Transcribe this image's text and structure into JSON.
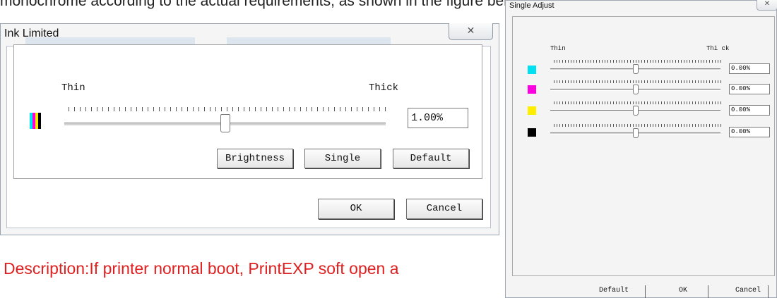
{
  "doc": {
    "top_text": "monochrome according to the actual requirements, as shown in the figure below",
    "bottom_text": "Description:If printer normal boot, PrintEXP soft open a"
  },
  "ink_limited": {
    "title": "Ink Limited",
    "close_glyph": "✕",
    "label_thin": "Thin",
    "label_thick": "Thick",
    "ink_colors": [
      "#00e5ee",
      "#ff00d8",
      "#f5e800",
      "#000000"
    ],
    "slider_level": 0.5,
    "value": "1.00%",
    "buttons": {
      "brightness": "Brightness",
      "single": "Single",
      "default": "Default"
    },
    "ok": "OK",
    "cancel": "Cancel"
  },
  "single_adjust": {
    "title": "Single Adjust",
    "close_glyph": "✕",
    "label_thin": "Thin",
    "label_thick": "Thi ck",
    "rows": [
      {
        "color": "#00e0f0",
        "value": "0.00%",
        "level": 0.5
      },
      {
        "color": "#ff00e0",
        "value": "0.00%",
        "level": 0.5
      },
      {
        "color": "#ffee00",
        "value": "0.00%",
        "level": 0.5
      },
      {
        "color": "#000000",
        "value": "0.00%",
        "level": 0.5
      }
    ],
    "default": "Default",
    "ok": "OK",
    "cancel": "Cancel"
  }
}
